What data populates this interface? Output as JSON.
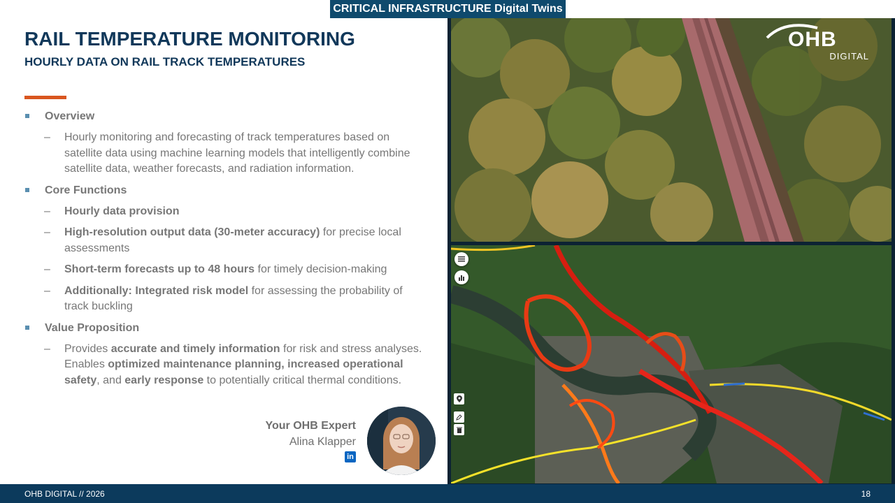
{
  "banner": "CRITICAL INFRASTRUCTURE Digital Twins",
  "title": "RAIL TEMPERATURE MONITORING",
  "subtitle": "HOURLY DATA ON RAIL TRACK TEMPERATURES",
  "logo": {
    "name": "OHB",
    "sub": "DIGITAL"
  },
  "sections": [
    {
      "heading": "Overview",
      "items": [
        {
          "parts": [
            {
              "t": "Hourly monitoring and forecasting of track temperatures based on satellite data using machine learning models that intelligently combine satellite data, weather forecasts, and radiation information."
            }
          ]
        }
      ]
    },
    {
      "heading": "Core Functions",
      "items": [
        {
          "parts": [
            {
              "t": "Hourly data provision",
              "b": true
            }
          ]
        },
        {
          "parts": [
            {
              "t": "High-resolution output data (30-meter accuracy)",
              "b": true
            },
            {
              "t": " for precise local assessments"
            }
          ]
        },
        {
          "parts": [
            {
              "t": "Short-term forecasts up to 48 hours",
              "b": true
            },
            {
              "t": " for timely decision-making"
            }
          ]
        },
        {
          "parts": [
            {
              "t": "Additionally: Integrated risk model",
              "b": true
            },
            {
              "t": " for assessing the probability of track buckling"
            }
          ]
        }
      ]
    },
    {
      "heading": "Value Proposition",
      "items": [
        {
          "parts": [
            {
              "t": "Provides "
            },
            {
              "t": "accurate and timely information",
              "b": true
            },
            {
              "t": " for risk and stress analyses. Enables "
            },
            {
              "t": "optimized maintenance planning, increased operational safety",
              "b": true
            },
            {
              "t": ", and "
            },
            {
              "t": "early response",
              "b": true
            },
            {
              "t": " to potentially critical thermal conditions."
            }
          ]
        }
      ]
    }
  ],
  "expert": {
    "heading": "Your OHB Expert",
    "name": "Alina Klapper",
    "linkedin_icon": "linkedin-icon"
  },
  "footer": {
    "left": "OHB DIGITAL // 2026",
    "page": "18"
  },
  "map_controls": {
    "round": [
      "menu-icon",
      "chart-icon"
    ],
    "square": [
      "location-pin-icon",
      "edit-icon",
      "delete-icon"
    ]
  },
  "colors": {
    "accent": "#d9561f",
    "navy": "#11385a",
    "banner": "#0f4a6d",
    "footer": "#0c3a5c"
  }
}
